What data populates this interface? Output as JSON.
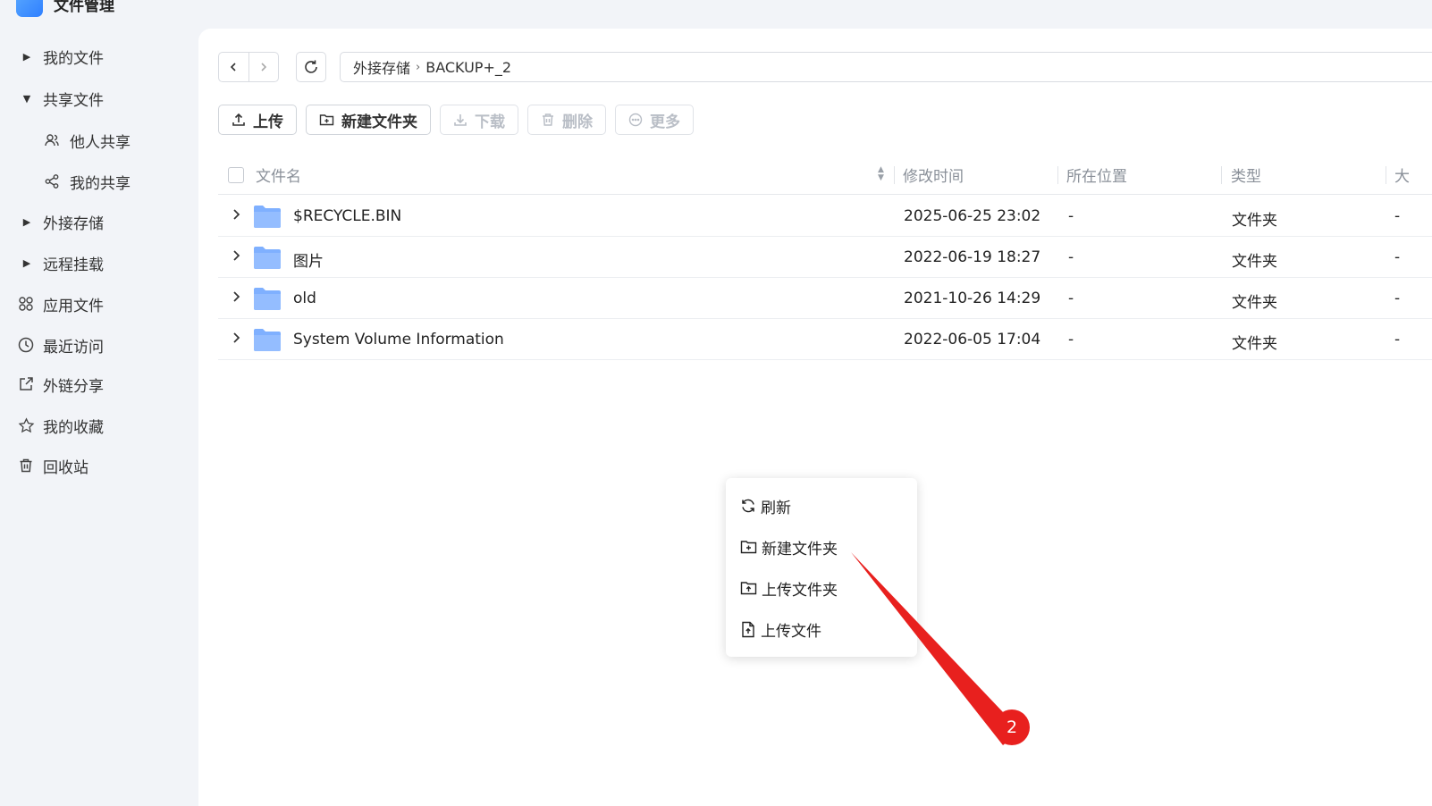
{
  "app": {
    "title": "文件管理"
  },
  "sidebar": {
    "items": [
      {
        "label": "我的文件",
        "icon": "caret-right-icon"
      },
      {
        "label": "共享文件",
        "icon": "caret-down-icon"
      },
      {
        "label": "他人共享",
        "icon": "users-icon"
      },
      {
        "label": "我的共享",
        "icon": "share-icon"
      },
      {
        "label": "外接存储",
        "icon": "caret-right-icon"
      },
      {
        "label": "远程挂载",
        "icon": "caret-right-icon"
      },
      {
        "label": "应用文件",
        "icon": "apps-icon"
      },
      {
        "label": "最近访问",
        "icon": "clock-icon"
      },
      {
        "label": "外链分享",
        "icon": "external-share-icon"
      },
      {
        "label": "我的收藏",
        "icon": "star-icon"
      },
      {
        "label": "回收站",
        "icon": "trash-icon"
      }
    ]
  },
  "breadcrumb": {
    "parent": "外接存储",
    "current": "BACKUP+_2"
  },
  "toolbar": {
    "upload": "上传",
    "new_folder": "新建文件夹",
    "download": "下载",
    "delete": "删除",
    "more": "更多"
  },
  "table": {
    "columns": {
      "name": "文件名",
      "mtime": "修改时间",
      "location": "所在位置",
      "type": "类型",
      "size": "大"
    },
    "rows": [
      {
        "name": "$RECYCLE.BIN",
        "mtime": "2025-06-25 23:02",
        "location": "-",
        "type": "文件夹",
        "size": "-"
      },
      {
        "name": "图片",
        "mtime": "2022-06-19 18:27",
        "location": "-",
        "type": "文件夹",
        "size": "-"
      },
      {
        "name": "old",
        "mtime": "2021-10-26 14:29",
        "location": "-",
        "type": "文件夹",
        "size": "-"
      },
      {
        "name": "System Volume Information",
        "mtime": "2022-06-05 17:04",
        "location": "-",
        "type": "文件夹",
        "size": "-"
      }
    ]
  },
  "context_menu": {
    "items": [
      {
        "label": "刷新",
        "icon": "refresh-icon"
      },
      {
        "label": "新建文件夹",
        "icon": "folder-plus-icon"
      },
      {
        "label": "上传文件夹",
        "icon": "folder-upload-icon"
      },
      {
        "label": "上传文件",
        "icon": "file-upload-icon"
      }
    ]
  },
  "annotation": {
    "badge": "2",
    "color": "#e8201e"
  },
  "colors": {
    "folder": "#7fb0ff",
    "accent": "#2f7fff",
    "background": "#f2f4f8"
  }
}
